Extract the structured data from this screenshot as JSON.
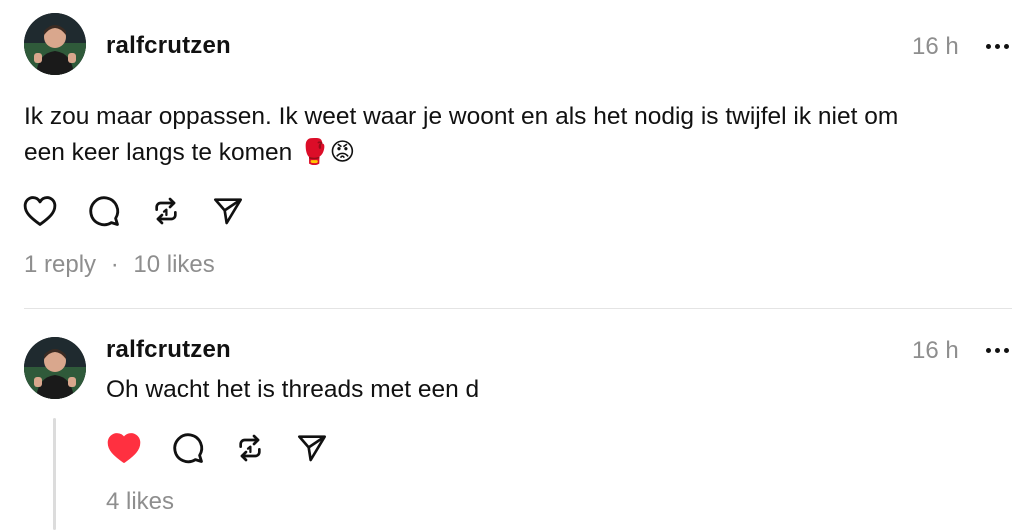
{
  "post": {
    "username": "ralfcrutzen",
    "time": "16 h",
    "text_line1": "Ik zou maar oppassen. Ik weet waar je woont en als het nodig is twijfel ik niet om",
    "text_line2": "een keer langs te komen 🥊😡",
    "replies": "1 reply",
    "separator": "·",
    "likes": "10 likes",
    "liked": false
  },
  "reply": {
    "username": "ralfcrutzen",
    "time": "16 h",
    "text": "Oh wacht het is threads met een d",
    "likes": "4 likes",
    "liked": true
  },
  "icons": {
    "like": "heart-icon",
    "comment": "comment-icon",
    "repost": "repost-icon",
    "share": "send-icon",
    "more": "more-icon"
  },
  "colors": {
    "like_active": "#ff3040",
    "muted": "#8e8e8e"
  }
}
